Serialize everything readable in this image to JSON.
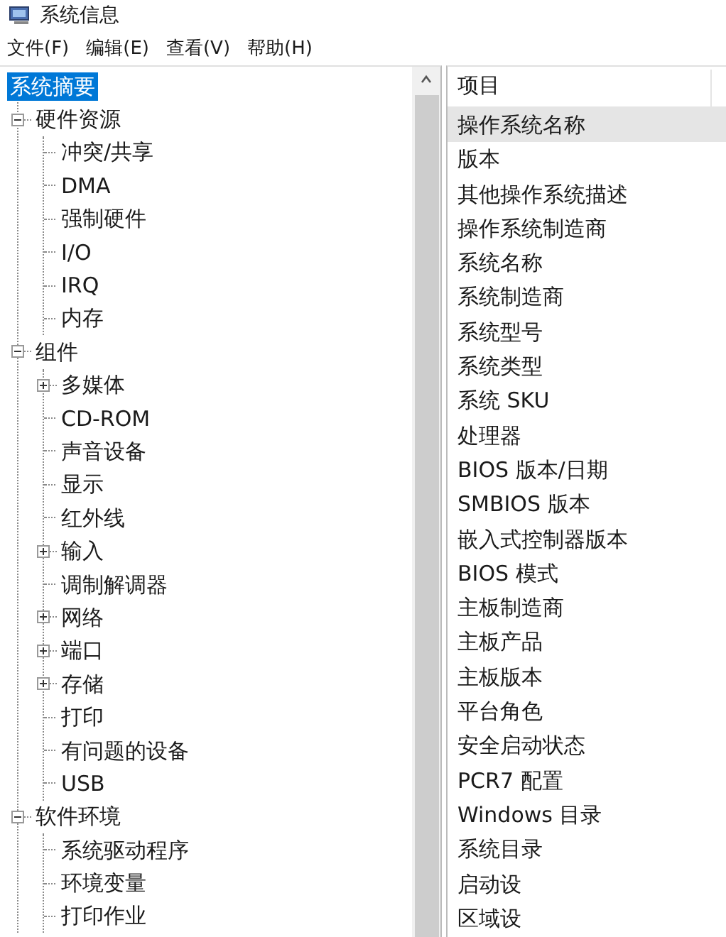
{
  "window": {
    "title": "系统信息"
  },
  "menu": [
    "文件(F)",
    "编辑(E)",
    "查看(V)",
    "帮助(H)"
  ],
  "tree": [
    {
      "label": "系统摘要",
      "selected": true,
      "children": [
        {
          "label": "硬件资源",
          "selected": false,
          "expanded": true,
          "children": [
            {
              "label": "冲突/共享",
              "selected": false
            },
            {
              "label": "DMA",
              "selected": false
            },
            {
              "label": "强制硬件",
              "selected": false
            },
            {
              "label": "I/O",
              "selected": false
            },
            {
              "label": "IRQ",
              "selected": false
            },
            {
              "label": "内存",
              "selected": false
            }
          ]
        },
        {
          "label": "组件",
          "selected": false,
          "expanded": true,
          "children": [
            {
              "label": "多媒体",
              "selected": false,
              "expanded": false
            },
            {
              "label": "CD-ROM",
              "selected": false
            },
            {
              "label": "声音设备",
              "selected": false
            },
            {
              "label": "显示",
              "selected": false
            },
            {
              "label": "红外线",
              "selected": false
            },
            {
              "label": "输入",
              "selected": false,
              "expanded": false
            },
            {
              "label": "调制解调器",
              "selected": false
            },
            {
              "label": "网络",
              "selected": false,
              "expanded": false
            },
            {
              "label": "端口",
              "selected": false,
              "expanded": false
            },
            {
              "label": "存储",
              "selected": false,
              "expanded": false
            },
            {
              "label": "打印",
              "selected": false
            },
            {
              "label": "有问题的设备",
              "selected": false
            },
            {
              "label": "USB",
              "selected": false
            }
          ]
        },
        {
          "label": "软件环境",
          "selected": false,
          "expanded": true,
          "children": [
            {
              "label": "系统驱动程序",
              "selected": false
            },
            {
              "label": "环境变量",
              "selected": false
            },
            {
              "label": "打印作业",
              "selected": false
            }
          ]
        }
      ]
    }
  ],
  "list": {
    "columns": [
      "项目"
    ],
    "rows": [
      {
        "label": "操作系统名称",
        "selected": true
      },
      {
        "label": "版本",
        "selected": false
      },
      {
        "label": "其他操作系统描述",
        "selected": false
      },
      {
        "label": "操作系统制造商",
        "selected": false
      },
      {
        "label": "系统名称",
        "selected": false
      },
      {
        "label": "系统制造商",
        "selected": false
      },
      {
        "label": "系统型号",
        "selected": false
      },
      {
        "label": "系统类型",
        "selected": false
      },
      {
        "label": "系统 SKU",
        "selected": false
      },
      {
        "label": "处理器",
        "selected": false
      },
      {
        "label": "BIOS 版本/日期",
        "selected": false
      },
      {
        "label": "SMBIOS 版本",
        "selected": false
      },
      {
        "label": "嵌入式控制器版本",
        "selected": false
      },
      {
        "label": "BIOS 模式",
        "selected": false
      },
      {
        "label": "主板制造商",
        "selected": false
      },
      {
        "label": "主板产品",
        "selected": false
      },
      {
        "label": "主板版本",
        "selected": false
      },
      {
        "label": "平台角色",
        "selected": false
      },
      {
        "label": "安全启动状态",
        "selected": false
      },
      {
        "label": "PCR7 配置",
        "selected": false
      },
      {
        "label": "Windows 目录",
        "selected": false
      },
      {
        "label": "系统目录",
        "selected": false
      },
      {
        "label": "启动设",
        "selected": false
      },
      {
        "label": "区域设",
        "selected": false
      }
    ]
  }
}
